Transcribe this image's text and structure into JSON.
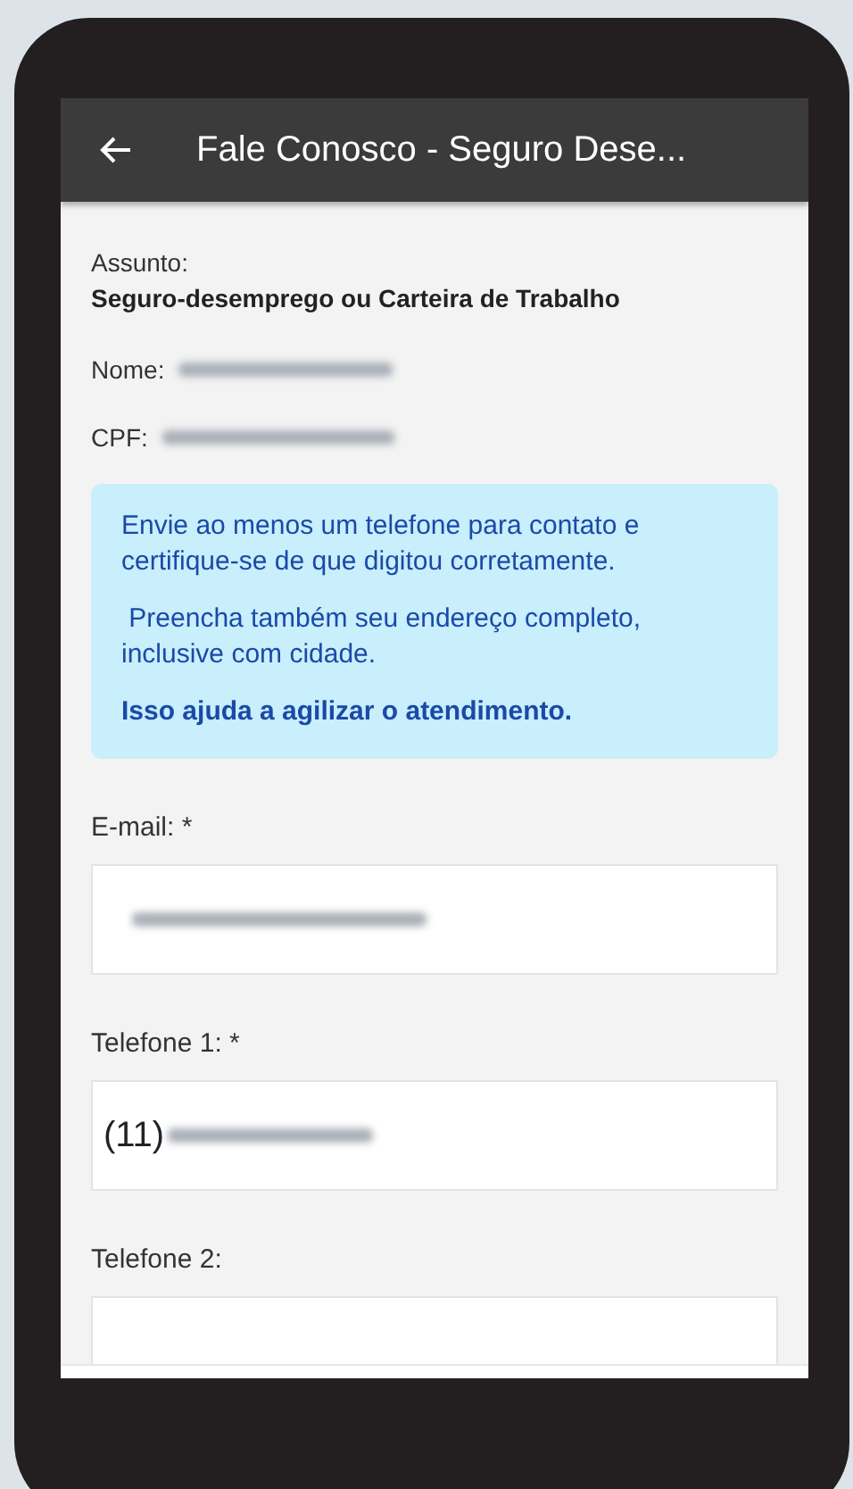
{
  "app_bar": {
    "title": "Fale Conosco - Seguro Dese..."
  },
  "subject": {
    "label": "Assunto:",
    "value": "Seguro-desemprego ou Carteira de Trabalho"
  },
  "info_rows": [
    {
      "label": "Nome:",
      "redacted": true
    },
    {
      "label": "CPF:",
      "redacted": true
    }
  ],
  "notice": {
    "paragraphs": [
      {
        "text": "Envie ao menos um telefone para contato e certifique-se de que digitou corretamente.",
        "bold": false
      },
      {
        "text": " Preencha também seu endereço completo, inclusive com cidade.",
        "bold": false
      },
      {
        "text": "Isso ajuda a agilizar o atendimento.",
        "bold": true
      }
    ]
  },
  "fields": [
    {
      "label": "E-mail: *",
      "redacted": true
    },
    {
      "label": "Telefone 1: *",
      "value": "(11)",
      "redacted": true
    },
    {
      "label": "Telefone 2:"
    }
  ]
}
